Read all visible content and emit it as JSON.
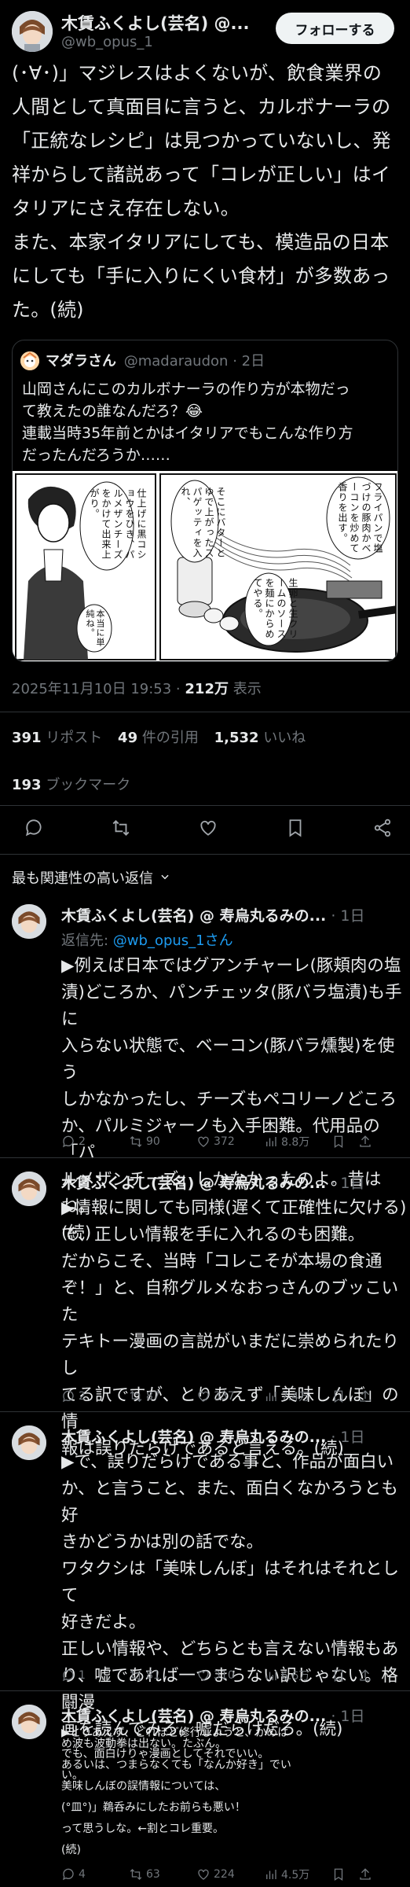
{
  "main": {
    "author_name": "木賃ふくよし(芸名) @...",
    "author_handle": "@wb_opus_1",
    "follow_label": "フォローする",
    "body_lines": [
      "(･∀･)」マジレスはよくないが、飲食業界の",
      "人間として真面目に言うと、カルボナーラの",
      "「正統なレシピ」は見つかっていないし、発",
      "祥からして諸説あって「コレが正しい」はイ",
      "タリアにさえ存在しない。",
      "また、本家イタリアにしても、模造品の日本",
      "にしても「手に入りにくい食材」が多数あっ",
      "た。(続)"
    ],
    "timestamp": "2025年11月10日 19:53 · ",
    "views_count": "212万",
    "views_label": "表示",
    "reposts_count": "391",
    "reposts_label": "リポスト",
    "quotes_count": "49",
    "quotes_label": "件の引用",
    "likes_count": "1,532",
    "likes_label": "いいね",
    "bookmarks_count": "193",
    "bookmarks_label": "ブックマーク"
  },
  "quote": {
    "name": "マダラさん",
    "handle": "@madaraudon",
    "time": "· 2日",
    "text_lines": [
      "山岡さんにこのカルボナーラの作り方が本物だっ",
      "て教えたの誰なんだろ？😂",
      "連載当時35年前とかはイタリアでもこんな作り方",
      "だったんだろうか……"
    ],
    "manga": {
      "bubble1": "仕上げに黒コショウをひき、パルメザンチーズをかけて出来上がり。",
      "bubble2": "そこにバターとゆで上がったスパゲッティを入れ、",
      "bubble3": "フライパンで塩づけの豚肉かベーコンを炒めて香りを出す。",
      "bubble4": "生卵と生クリームのソースを麺にからめてやる。",
      "bubble5": "本当に単純ね。"
    }
  },
  "sort_label": "最も関連性の高い返信",
  "replies": [
    {
      "name": "木賃ふくよし(芸名) @ 寿烏丸るみの...",
      "time": "· 1日",
      "reply_to_label": "返信先: ",
      "reply_to_handle": "@wb_opus_1さん",
      "lines": [
        "▶例えば日本ではグアンチャーレ(豚頬肉の塩",
        "漬)どころか、パンチェッタ(豚バラ塩漬)も手に",
        "入らない状態で、ベーコン(豚バラ燻製)を使う",
        "しかなかったし、チーズもペコリーノどころ",
        "か、パルミジャーノも入手困難。代用品の「パ",
        "ルメザンチーズ」しかなかったのよ。昔はね。",
        "(続)"
      ],
      "replies": "2",
      "reposts": "90",
      "likes": "372",
      "views": "8.8万"
    },
    {
      "name": "木賃ふくよし(芸名) @ 寿烏丸るみの...",
      "time": "· 1日",
      "lines": [
        "▶情報に関しても同様(遅くて正確性に欠ける)",
        "で、正しい情報を手に入れるのも困難。",
        "だからこそ、当時「コレこそが本場の食通",
        "ぞ！」と、自称グルメなおっさんのブッこいた",
        "テキトー漫画の言説がいまだに崇められたりし",
        "てる訳ですが、とりあえず「美味しんぼ」の情",
        "報は誤りだらけであると言える。(続)"
      ],
      "replies": "2",
      "reposts": "87",
      "likes": "337",
      "views": "7.4万"
    },
    {
      "name": "木賃ふくよし(芸名) @ 寿烏丸るみの...",
      "time": "· 1日",
      "lines": [
        "▶で、誤りだらけである事と、作品が面白い",
        "か、と言うこと、また、面白くなかろうとも好",
        "きかどうかは別の話でな。",
        "ワタクシは「美味しんぼ」はそれはそれとして",
        "好きだよ。",
        "正しい情報や、どちらとも言えない情報もあ",
        "り、嘘であれば一つまらない訳じゃない。格闘漫",
        "画を読んでみろ。嘘だらけだろ。(続)"
      ],
      "replies": "1",
      "reposts": "81",
      "likes": "310",
      "views": "6.6万"
    },
    {
      "name": "木賃ふくよし(芸名) @ 寿烏丸るみの...",
      "time": "· 1日",
      "lines": [
        "▶とりあえず、どれほど修行しようと、かめは",
        "め波も波動拳は出ない。たぶん。",
        "でも、面白けりゃ漫画としてそれでいい。",
        "あるいは、つまらなくても「なんか好き」でい",
        "い。",
        "美味しんぼの誤情報については、",
        "",
        "(°皿°)」鵜呑みにしたお前らも悪い！",
        "",
        "って思うしな。←割とコレ重要。",
        "",
        "(続)"
      ],
      "replies": "4",
      "reposts": "63",
      "likes": "224",
      "views": "4.5万"
    }
  ]
}
